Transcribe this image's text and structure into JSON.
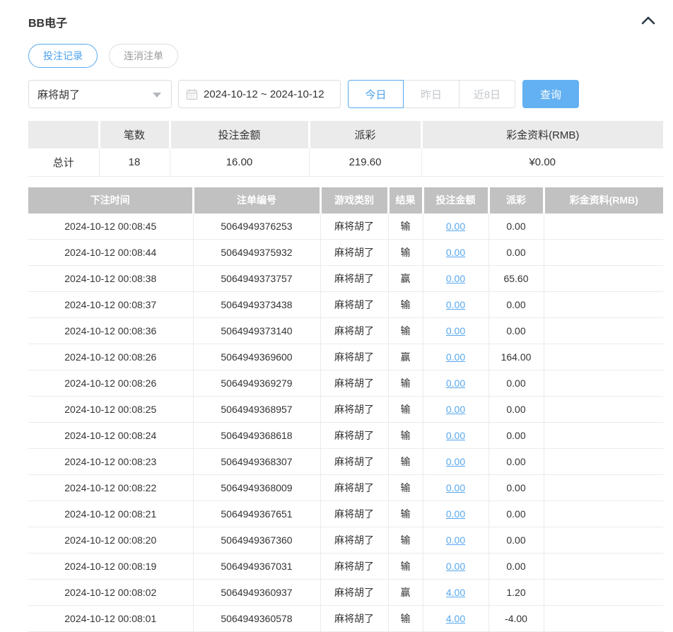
{
  "panel": {
    "title": "BB电子"
  },
  "tabs": [
    {
      "label": "投注记录",
      "active": true
    },
    {
      "label": "连消注单",
      "active": false
    }
  ],
  "filters": {
    "game_select": {
      "value": "麻将胡了"
    },
    "date_range": {
      "value": "2024-10-12 ~ 2024-10-12"
    },
    "quick_buttons": [
      {
        "label": "今日",
        "active": true
      },
      {
        "label": "昨日",
        "active": false
      },
      {
        "label": "近8日",
        "active": false
      }
    ],
    "query_label": "查询"
  },
  "summary": {
    "headers": [
      "",
      "笔数",
      "投注金额",
      "派彩",
      "彩金资料(RMB)"
    ],
    "row": {
      "label": "总计",
      "count": "18",
      "bet_amount": "16.00",
      "payout": "219.60",
      "bonus": "¥0.00"
    }
  },
  "table": {
    "headers": [
      "下注时间",
      "注单编号",
      "游戏类别",
      "结果",
      "投注金额",
      "派彩",
      "彩金资料(RMB)"
    ],
    "link_columns": [
      4
    ],
    "negative_color_column": 5,
    "rows": [
      [
        "2024-10-12 00:08:45",
        "5064949376253",
        "麻将胡了",
        "输",
        "0.00",
        "0.00",
        ""
      ],
      [
        "2024-10-12 00:08:44",
        "5064949375932",
        "麻将胡了",
        "输",
        "0.00",
        "0.00",
        ""
      ],
      [
        "2024-10-12 00:08:38",
        "5064949373757",
        "麻将胡了",
        "赢",
        "0.00",
        "65.60",
        ""
      ],
      [
        "2024-10-12 00:08:37",
        "5064949373438",
        "麻将胡了",
        "输",
        "0.00",
        "0.00",
        ""
      ],
      [
        "2024-10-12 00:08:36",
        "5064949373140",
        "麻将胡了",
        "输",
        "0.00",
        "0.00",
        ""
      ],
      [
        "2024-10-12 00:08:26",
        "5064949369600",
        "麻将胡了",
        "赢",
        "0.00",
        "164.00",
        ""
      ],
      [
        "2024-10-12 00:08:26",
        "5064949369279",
        "麻将胡了",
        "输",
        "0.00",
        "0.00",
        ""
      ],
      [
        "2024-10-12 00:08:25",
        "5064949368957",
        "麻将胡了",
        "输",
        "0.00",
        "0.00",
        ""
      ],
      [
        "2024-10-12 00:08:24",
        "5064949368618",
        "麻将胡了",
        "输",
        "0.00",
        "0.00",
        ""
      ],
      [
        "2024-10-12 00:08:23",
        "5064949368307",
        "麻将胡了",
        "输",
        "0.00",
        "0.00",
        ""
      ],
      [
        "2024-10-12 00:08:22",
        "5064949368009",
        "麻将胡了",
        "输",
        "0.00",
        "0.00",
        ""
      ],
      [
        "2024-10-12 00:08:21",
        "5064949367651",
        "麻将胡了",
        "输",
        "0.00",
        "0.00",
        ""
      ],
      [
        "2024-10-12 00:08:20",
        "5064949367360",
        "麻将胡了",
        "输",
        "0.00",
        "0.00",
        ""
      ],
      [
        "2024-10-12 00:08:19",
        "5064949367031",
        "麻将胡了",
        "输",
        "0.00",
        "0.00",
        ""
      ],
      [
        "2024-10-12 00:08:02",
        "5064949360937",
        "麻将胡了",
        "赢",
        "4.00",
        "1.20",
        ""
      ],
      [
        "2024-10-12 00:08:01",
        "5064949360578",
        "麻将胡了",
        "输",
        "4.00",
        "-4.00",
        ""
      ]
    ]
  },
  "colors": {
    "accent_blue": "#63b1f2",
    "link_blue": "#58a8ef",
    "negative_red": "#f4565c",
    "table_header_gray": "#c1c1c1",
    "summary_header_gray": "#ebebeb"
  }
}
